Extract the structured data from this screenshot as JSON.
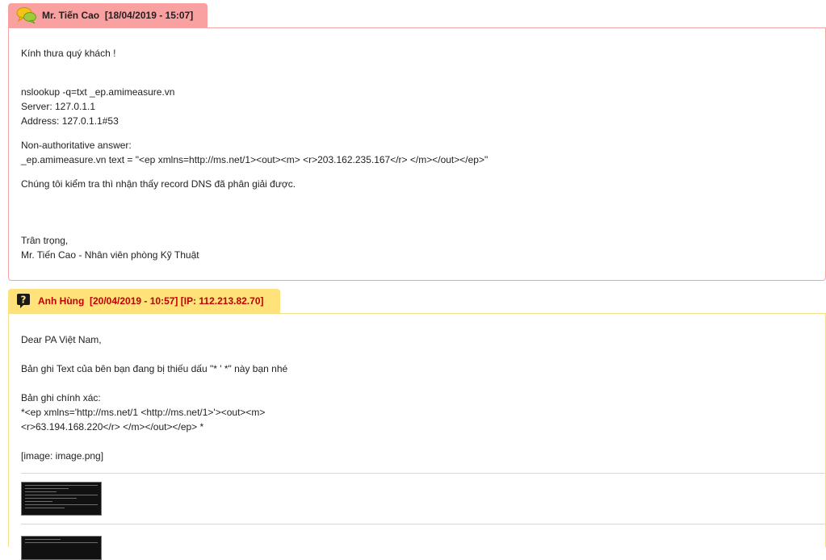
{
  "staff_reply": {
    "author": "Mr. Tiến Cao",
    "datetime": "[18/04/2019 - 15:07]",
    "lines": [
      "Kính thưa quý khách !",
      "nslookup -q=txt _ep.amimeasure.vn",
      "Server: 127.0.1.1",
      "Address: 127.0.1.1#53",
      "Non-authoritative answer:",
      "_ep.amimeasure.vn text = \"<ep xmlns=http://ms.net/1><out><m> <r>203.162.235.167</r> </m></out></ep>\"",
      "Chúng tôi kiểm tra thì nhận thấy record DNS đã phân giải được.",
      "Trân trọng,",
      "Mr. Tiến Cao - Nhân viên phòng Kỹ Thuật"
    ]
  },
  "customer_reply": {
    "author": "Anh Hùng",
    "datetime": "[20/04/2019 - 10:57]",
    "ip": "[IP: 112.213.82.70]",
    "lines": [
      "Dear PA Việt Nam,",
      "Bản ghi Text của bên bạn đang bị thiếu dấu \"* ' *\" này bạn nhé",
      "Bản ghi chính xác:",
      "*<ep xmlns='http://ms.net/1 <http://ms.net/1>'><out><m>",
      "<r>63.194.168.220</r> </m></out></ep> *",
      "[image: image.png]"
    ]
  },
  "colors": {
    "staff_tab": "#f9a0a0",
    "customer_tab": "#ffe27a",
    "customer_name": "#c00000"
  },
  "icons": {
    "staff": "chat-bubbles-icon",
    "customer": "question-icon"
  }
}
